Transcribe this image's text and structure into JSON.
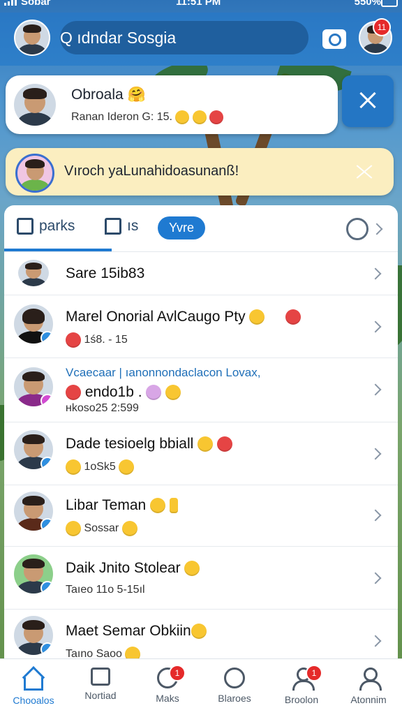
{
  "status": {
    "carrier": "Sobar",
    "time": "11:51 PM",
    "battery": "550%"
  },
  "search": {
    "placeholder": "Q ıdndar Sosgia"
  },
  "header": {
    "profile_badge": "11"
  },
  "story": {
    "title": "Obroala 🤗",
    "subtitle": "Ranan Ideron G: 15."
  },
  "notice": {
    "text": "Vıroch yaLunahidoasunanß!"
  },
  "tabs": [
    {
      "label": "parks"
    },
    {
      "label": "ıs"
    },
    {
      "label": "Yvre"
    }
  ],
  "chats": [
    {
      "name": "Sare 15ib83",
      "meta": ""
    },
    {
      "name": "Marel Onorial AvlCaugo Pty",
      "meta": "1ś8. - 15"
    },
    {
      "name": "Vcaecaar | ıanonnondaclacon Lovax,",
      "meta": "endo1b .",
      "meta2": "ʜkoso25   2:599"
    },
    {
      "name": "Dade tesioelg bbiall",
      "meta": "1oSk5"
    },
    {
      "name": "Libar Teman",
      "meta": "Sossar"
    },
    {
      "name": "Daik Jnito Stolear",
      "meta": "Taıeo 11o   5-15ıl"
    },
    {
      "name": "Maet Semar Obkiin",
      "meta": "Taıno Saoo"
    }
  ],
  "bottom_nav": [
    {
      "label": "Chooalos",
      "icon": "home-icon",
      "active": true
    },
    {
      "label": "Nortiad",
      "icon": "notice-icon"
    },
    {
      "label": "Maks",
      "icon": "chat-icon",
      "badge": "1"
    },
    {
      "label": "Blaroes",
      "icon": "search-icon"
    },
    {
      "label": "Broolon",
      "icon": "group-icon",
      "badge": "1"
    },
    {
      "label": "Atonnim",
      "icon": "profile-icon"
    }
  ],
  "colors": {
    "primary": "#1f7ad1",
    "notice": "#fbeec0",
    "badge": "#e52a2a"
  }
}
